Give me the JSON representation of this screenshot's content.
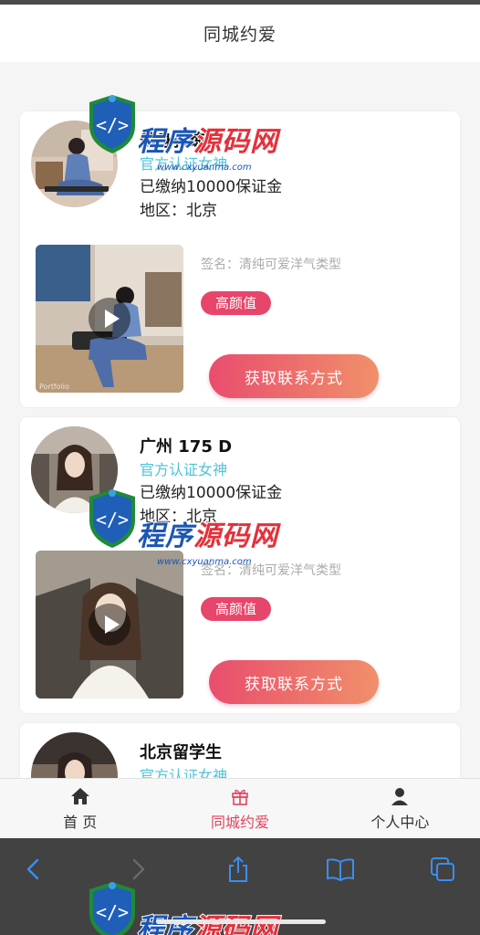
{
  "header": {
    "title": "同城约爱"
  },
  "cards": [
    {
      "name": "健身教练",
      "verified": "官方认证女神",
      "deposit": "已缴纳10000保证金",
      "region": "地区：北京",
      "signature": "签名：清纯可爱洋气类型",
      "tag": "高颜值",
      "cta": "获取联系方式",
      "video_caption": "Portfolio"
    },
    {
      "name": "广州 175 D",
      "verified": "官方认证女神",
      "deposit": "已缴纳10000保证金",
      "region": "地区：北京",
      "signature": "签名：清纯可爱洋气类型",
      "tag": "高颜值",
      "cta": "获取联系方式"
    },
    {
      "name": "北京留学生",
      "verified": "官方认证女神"
    }
  ],
  "tabbar": {
    "items": [
      {
        "label": "首 页",
        "icon": "home-icon"
      },
      {
        "label": "同城约爱",
        "icon": "gift-icon",
        "active": true
      },
      {
        "label": "个人中心",
        "icon": "user-icon"
      }
    ]
  },
  "browser": {
    "icons": [
      "back-icon",
      "forward-icon",
      "share-icon",
      "bookmarks-icon",
      "tabs-icon"
    ]
  },
  "watermark": {
    "text_blue": "程序",
    "text_red": "源码网",
    "url": "www.cxyuanma.com"
  },
  "colors": {
    "accent": "#e0455f",
    "verified": "#4fc3d9",
    "cta_start": "#e94d6e",
    "cta_end": "#f0906a",
    "tag_bg": "#e8456a"
  }
}
